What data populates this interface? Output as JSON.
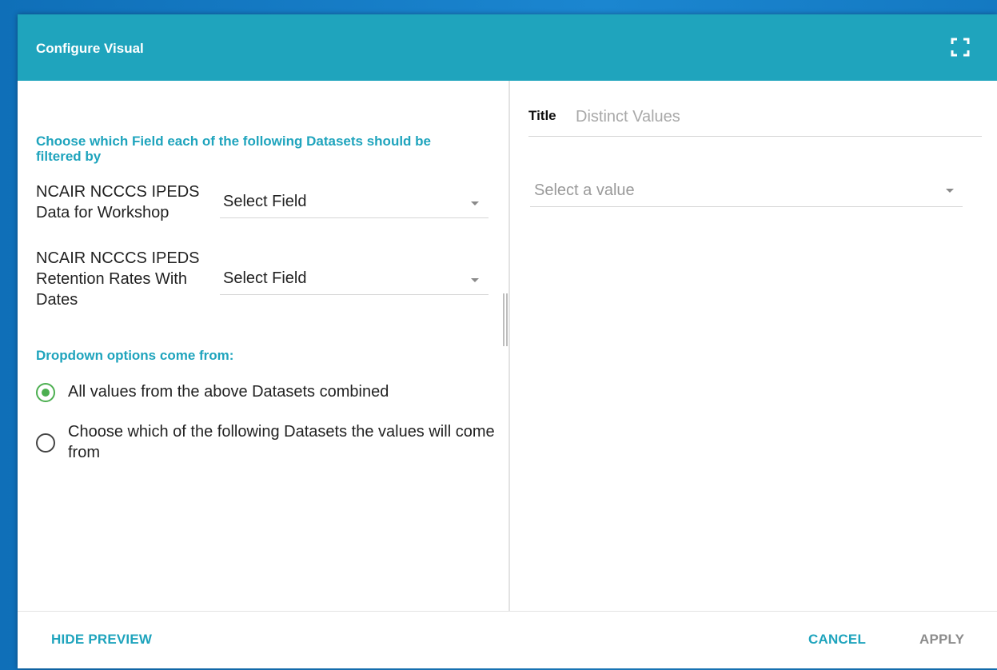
{
  "dialog": {
    "title": "Configure Visual"
  },
  "left": {
    "filter_heading": "Choose which Field each of the following Datasets should be filtered by",
    "datasets": [
      {
        "label": "NCAIR NCCCS IPEDS Data for Workshop",
        "field_value": "Select Field"
      },
      {
        "label": "NCAIR NCCCS IPEDS Retention Rates With Dates",
        "field_value": "Select Field"
      }
    ],
    "options_heading": "Dropdown options come from:",
    "radio_options": [
      {
        "label": "All values from the above Datasets combined",
        "checked": true
      },
      {
        "label": "Choose which of the following Datasets the values will come from",
        "checked": false
      }
    ]
  },
  "right": {
    "title_label": "Title",
    "title_placeholder": "Distinct Values",
    "value_select": "Select a value"
  },
  "footer": {
    "hide_preview": "HIDE PREVIEW",
    "cancel": "CANCEL",
    "apply": "APPLY"
  },
  "colors": {
    "accent": "#1fa4bd",
    "radio_checked": "#4caf50",
    "backdrop": "#1479c2",
    "disabled_text": "#8c8c8c"
  },
  "icons": {
    "fullscreen": "fullscreen-icon",
    "caret": "caret-down-icon"
  }
}
